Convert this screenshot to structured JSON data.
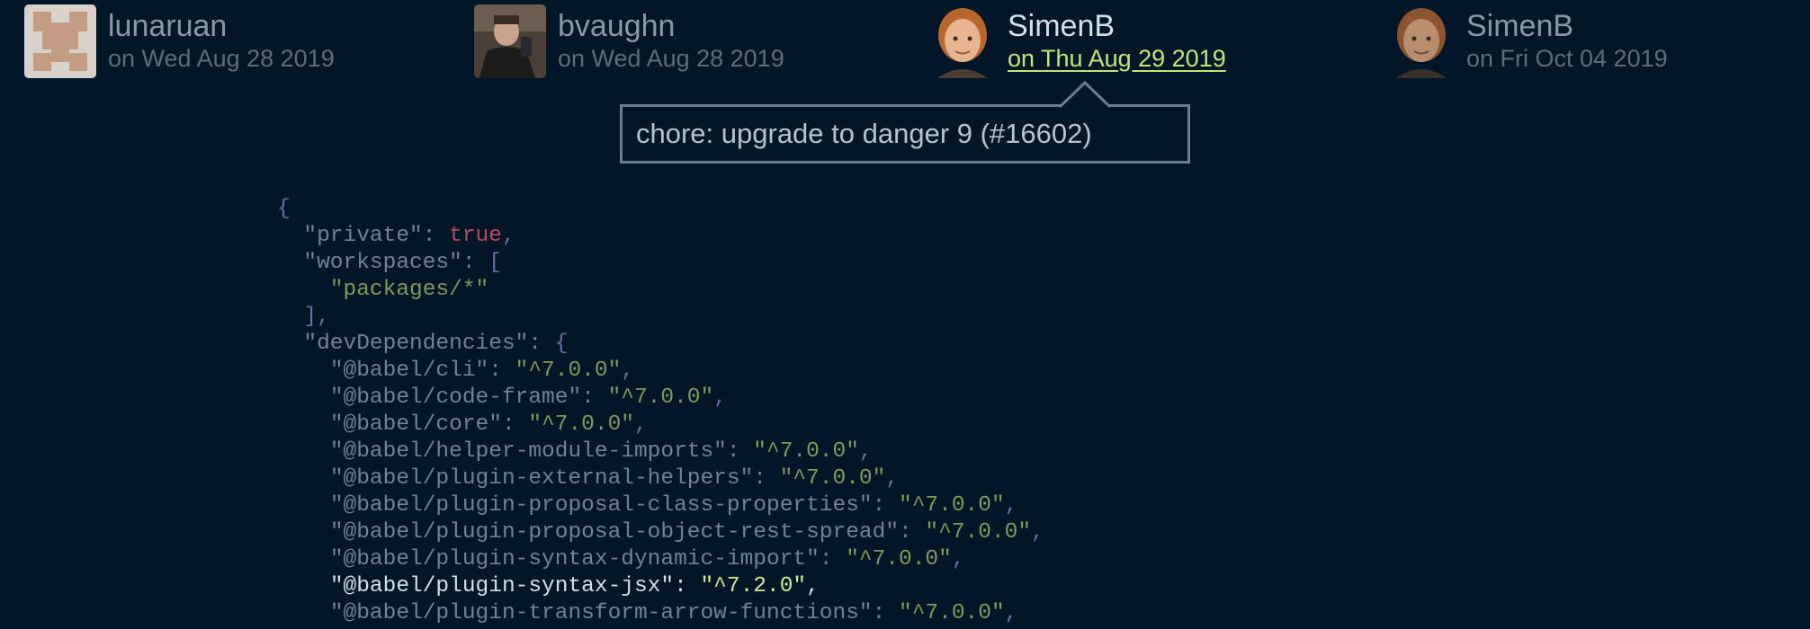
{
  "commits": [
    {
      "author": "lunaruan",
      "date": "on Wed Aug 28 2019",
      "avatar": "pixel-identicon-avatar",
      "active": false
    },
    {
      "author": "bvaughn",
      "date": "on Wed Aug 28 2019",
      "avatar": "photo-avatar",
      "active": false
    },
    {
      "author": "SimenB",
      "date": "on Thu Aug 29 2019",
      "avatar": "photo-avatar",
      "active": true
    },
    {
      "author": "SimenB",
      "date": "on Fri Oct 04 2019",
      "avatar": "photo-avatar",
      "active": false
    }
  ],
  "tooltip": {
    "message": "chore: upgrade to danger 9 (#16602)"
  },
  "code": {
    "lines": [
      {
        "indent": "",
        "tokens": [
          [
            "{",
            "punct"
          ]
        ]
      },
      {
        "indent": "  ",
        "tokens": [
          [
            "\"private\"",
            "key"
          ],
          [
            ": ",
            "colon"
          ],
          [
            "true",
            "bool"
          ],
          [
            ",",
            "punct"
          ]
        ]
      },
      {
        "indent": "  ",
        "tokens": [
          [
            "\"workspaces\"",
            "key"
          ],
          [
            ": ",
            "colon"
          ],
          [
            "[",
            "punct"
          ]
        ]
      },
      {
        "indent": "    ",
        "tokens": [
          [
            "\"packages/*\"",
            "str"
          ]
        ]
      },
      {
        "indent": "  ",
        "tokens": [
          [
            "],",
            "punct"
          ]
        ]
      },
      {
        "indent": "  ",
        "tokens": [
          [
            "\"devDependencies\"",
            "key"
          ],
          [
            ": ",
            "colon"
          ],
          [
            "{",
            "punct"
          ]
        ]
      },
      {
        "indent": "    ",
        "tokens": [
          [
            "\"@babel/cli\"",
            "key"
          ],
          [
            ": ",
            "colon"
          ],
          [
            "\"^7.0.0\"",
            "str"
          ],
          [
            ",",
            "punct"
          ]
        ]
      },
      {
        "indent": "    ",
        "tokens": [
          [
            "\"@babel/code-frame\"",
            "key"
          ],
          [
            ": ",
            "colon"
          ],
          [
            "\"^7.0.0\"",
            "str"
          ],
          [
            ",",
            "punct"
          ]
        ]
      },
      {
        "indent": "    ",
        "tokens": [
          [
            "\"@babel/core\"",
            "key"
          ],
          [
            ": ",
            "colon"
          ],
          [
            "\"^7.0.0\"",
            "str"
          ],
          [
            ",",
            "punct"
          ]
        ]
      },
      {
        "indent": "    ",
        "tokens": [
          [
            "\"@babel/helper-module-imports\"",
            "key"
          ],
          [
            ": ",
            "colon"
          ],
          [
            "\"^7.0.0\"",
            "str"
          ],
          [
            ",",
            "punct"
          ]
        ]
      },
      {
        "indent": "    ",
        "tokens": [
          [
            "\"@babel/plugin-external-helpers\"",
            "key"
          ],
          [
            ": ",
            "colon"
          ],
          [
            "\"^7.0.0\"",
            "str"
          ],
          [
            ",",
            "punct"
          ]
        ]
      },
      {
        "indent": "    ",
        "tokens": [
          [
            "\"@babel/plugin-proposal-class-properties\"",
            "key"
          ],
          [
            ": ",
            "colon"
          ],
          [
            "\"^7.0.0\"",
            "str"
          ],
          [
            ",",
            "punct"
          ]
        ]
      },
      {
        "indent": "    ",
        "tokens": [
          [
            "\"@babel/plugin-proposal-object-rest-spread\"",
            "key"
          ],
          [
            ": ",
            "colon"
          ],
          [
            "\"^7.0.0\"",
            "str"
          ],
          [
            ",",
            "punct"
          ]
        ]
      },
      {
        "indent": "    ",
        "tokens": [
          [
            "\"@babel/plugin-syntax-dynamic-import\"",
            "key"
          ],
          [
            ": ",
            "colon"
          ],
          [
            "\"^7.0.0\"",
            "str"
          ],
          [
            ",",
            "punct"
          ]
        ]
      },
      {
        "indent": "    ",
        "highlight": true,
        "tokens": [
          [
            "\"@babel/plugin-syntax-jsx\"",
            "key"
          ],
          [
            ": ",
            "colon"
          ],
          [
            "\"^7.2.0\"",
            "str"
          ],
          [
            ",",
            "punct"
          ]
        ]
      },
      {
        "indent": "    ",
        "tokens": [
          [
            "\"@babel/plugin-transform-arrow-functions\"",
            "key"
          ],
          [
            ": ",
            "colon"
          ],
          [
            "\"^7.0.0\"",
            "str"
          ],
          [
            ",",
            "punct"
          ]
        ]
      }
    ]
  },
  "colors": {
    "background": "#011627",
    "active_author": "#d6deeb",
    "active_date_link": "#c5e478",
    "tooltip_border": "#6b7d8e"
  }
}
